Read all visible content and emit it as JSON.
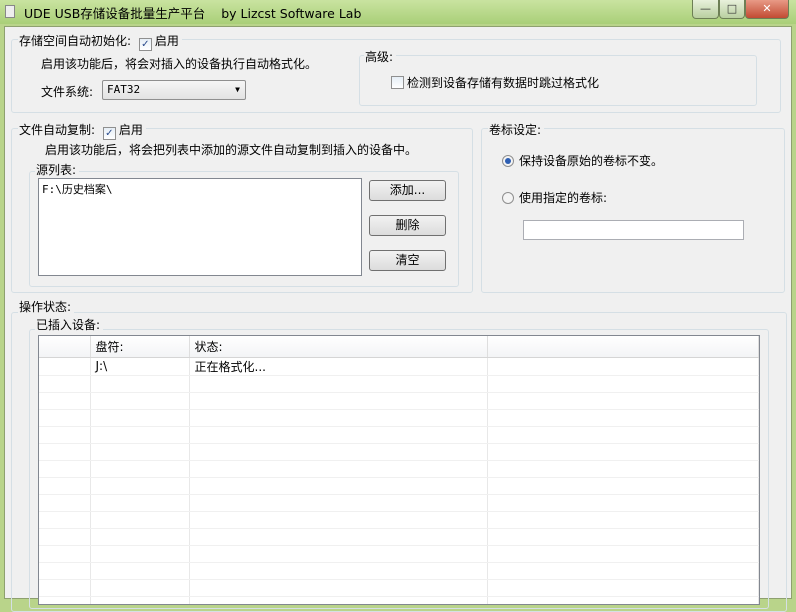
{
  "window": {
    "title": "UDE USB存储设备批量生产平台    by Lizcst Software Lab",
    "minimize": "—",
    "maximize": "□",
    "close": "✕"
  },
  "storage_init": {
    "legend": "存储空间自动初始化:",
    "enable_label": "启用",
    "enabled": true,
    "description": "启用该功能后，将会对插入的设备执行自动格式化。",
    "fs_label": "文件系统:",
    "fs_value": "FAT32"
  },
  "advanced": {
    "legend": "高级:",
    "skip_label": "检测到设备存储有数据时跳过格式化",
    "skip_checked": false
  },
  "file_copy": {
    "legend": "文件自动复制:",
    "enable_label": "启用",
    "enabled": true,
    "description": "启用该功能后，将会把列表中添加的源文件自动复制到插入的设备中。",
    "source_legend": "源列表:",
    "sources": [
      "F:\\历史档案\\"
    ],
    "add_button": "添加...",
    "delete_button": "删除",
    "clear_button": "清空"
  },
  "volume": {
    "legend": "卷标设定:",
    "keep_label": "保持设备原始的卷标不变。",
    "custom_label": "使用指定的卷标:",
    "selected": "keep",
    "custom_value": ""
  },
  "status": {
    "legend": "操作状态:",
    "devices_legend": "已插入设备:",
    "columns": [
      "",
      "盘符:",
      "状态:",
      ""
    ],
    "rows": [
      [
        "",
        "J:\\",
        "正在格式化...",
        ""
      ]
    ]
  }
}
